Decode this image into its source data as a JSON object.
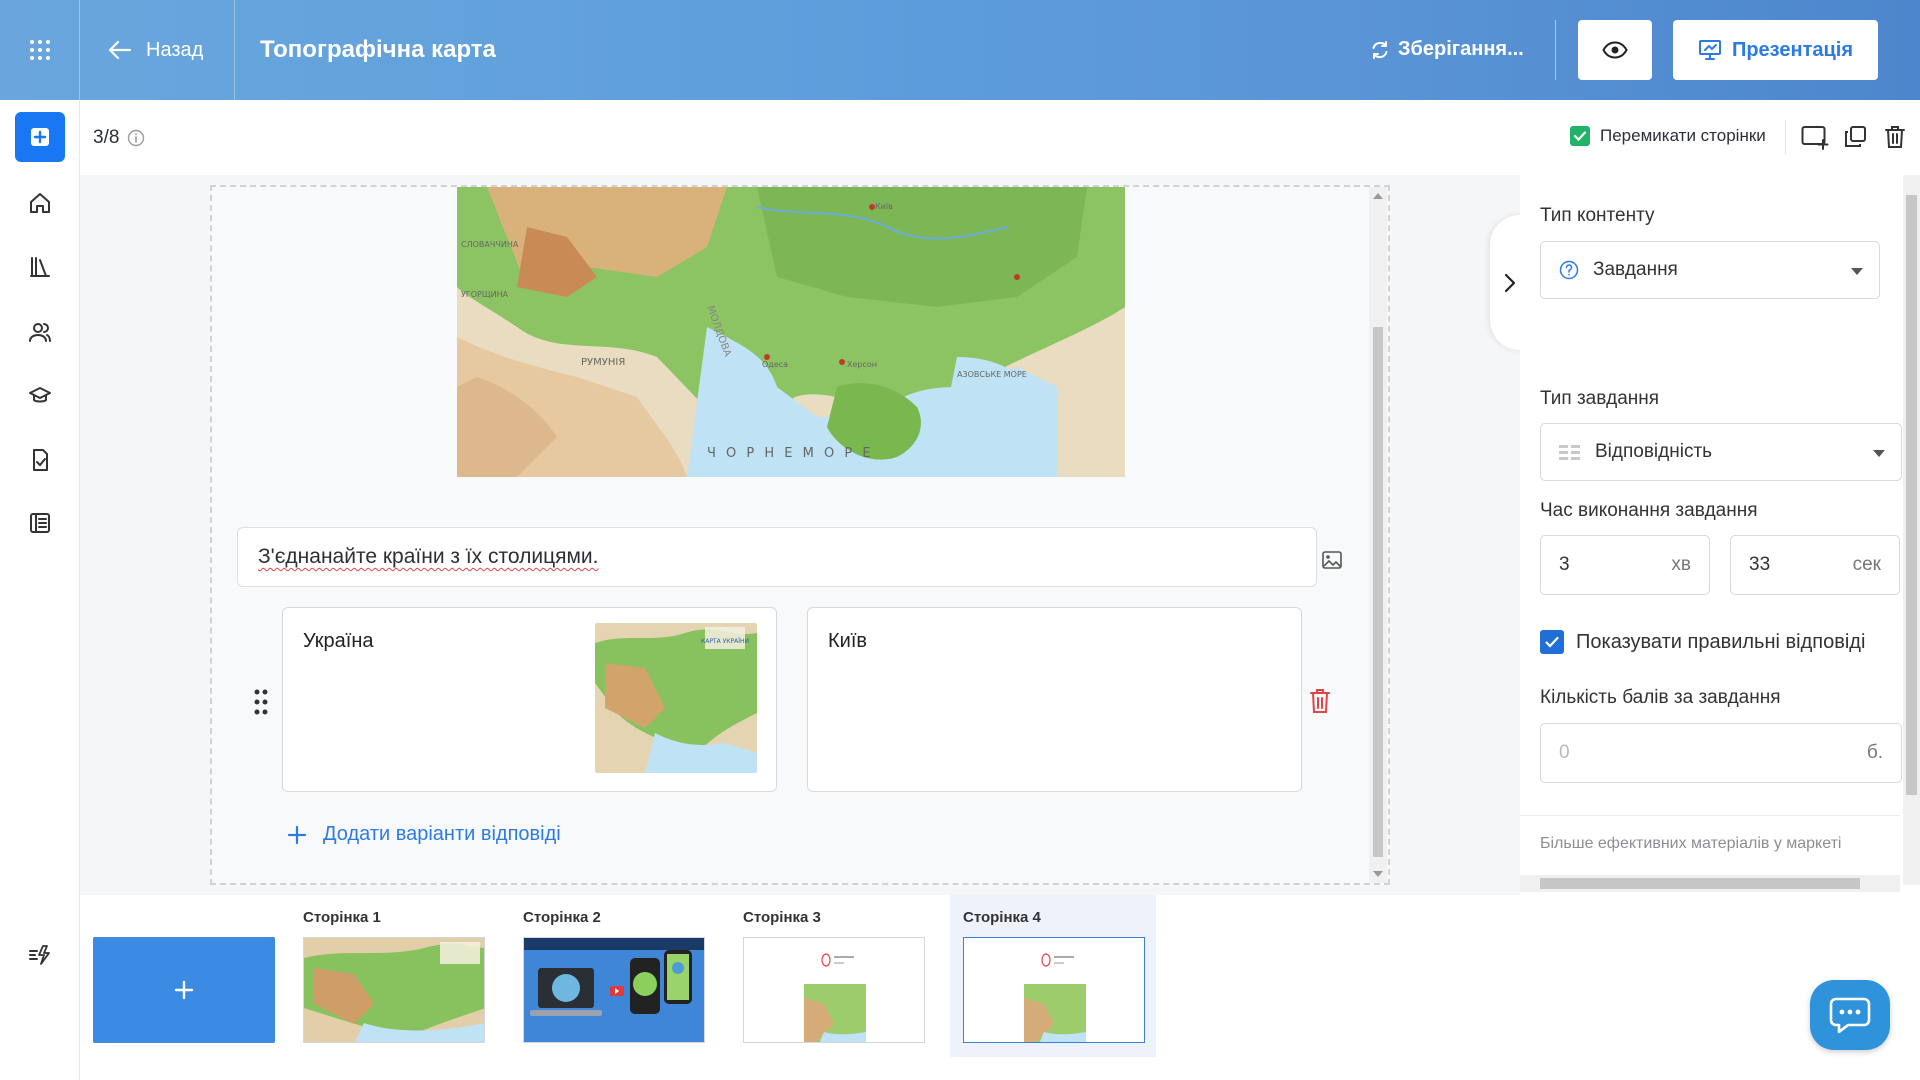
{
  "header": {
    "back_label": "Назад",
    "title": "Топографічна карта",
    "saving_label": "Зберігання...",
    "present_label": "Презентація"
  },
  "toolbar": {
    "page_counter": "3/8",
    "switch_pages_label": "Перемикати сторінки"
  },
  "map_labels": {
    "romania": "РУМУНІЯ",
    "moldova": "МОЛДОВА",
    "black_sea": "Ч О Р Н Е       М О Р Е",
    "azov_sea": "АЗОВСЬКЕ МОРЕ",
    "slovakia": "СЛОВАЧЧИНА",
    "hungary": "УГОРЩИНА",
    "kherson": "Херсон",
    "odesa": "Одеса",
    "kyiv_city": "Київ"
  },
  "editor": {
    "question": "З'єднанайте країни з їх столицями.",
    "pair": {
      "left": "Україна",
      "right": "Київ",
      "thumb_caption": "КАРТА УКРАЇНИ"
    },
    "add_answers_label": "Додати варіанти відповіді"
  },
  "panel": {
    "content_type_label": "Тип контенту",
    "content_type_value": "Завдання",
    "task_type_label": "Тип завдання",
    "task_type_value": "Відповідність",
    "time_label": "Час виконання завдання",
    "minutes": "3",
    "minutes_unit": "хв",
    "seconds": "33",
    "seconds_unit": "сек",
    "show_answers_label": "Показувати правильні відповіді",
    "points_label": "Кількість балів за завдання",
    "points_placeholder": "0",
    "points_unit": "б.",
    "more_materials": "Більше ефективних матеріалів у маркеті"
  },
  "pages": [
    {
      "title": "Сторінка 1"
    },
    {
      "title": "Сторінка 2"
    },
    {
      "title": "Сторінка 3"
    },
    {
      "title": "Сторінка 4"
    }
  ],
  "colors": {
    "accent": "#2c7be5",
    "header_start": "#6aa6dd",
    "header_end": "#4d86cc",
    "danger": "#e04545",
    "success": "#22b36b"
  }
}
